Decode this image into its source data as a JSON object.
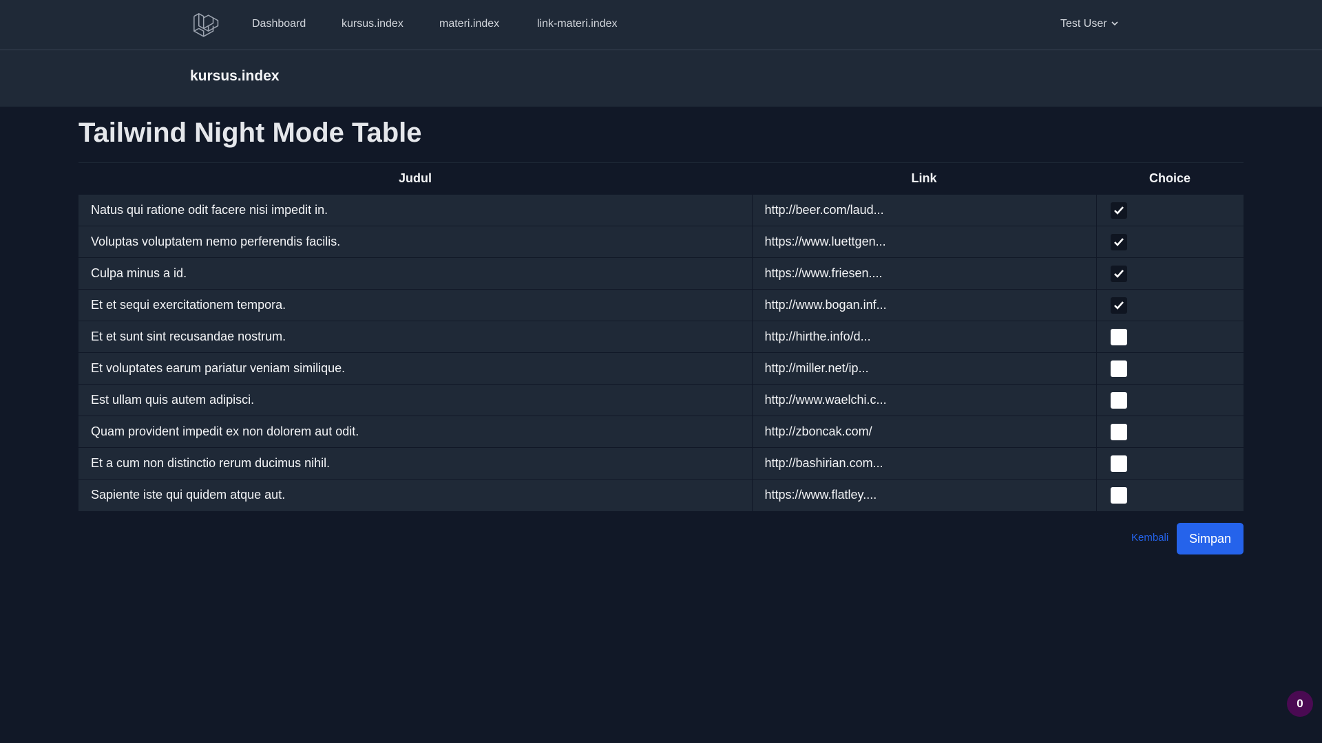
{
  "nav": {
    "items": [
      {
        "label": "Dashboard"
      },
      {
        "label": "kursus.index"
      },
      {
        "label": "materi.index"
      },
      {
        "label": "link-materi.index"
      }
    ],
    "user_name": "Test User"
  },
  "header": {
    "title": "kursus.index"
  },
  "main": {
    "title": "Tailwind Night Mode Table",
    "columns": [
      "Judul",
      "Link",
      "Choice"
    ],
    "rows": [
      {
        "judul": "Natus qui ratione odit facere nisi impedit in.",
        "link": "http://beer.com/laud...",
        "checked": true
      },
      {
        "judul": "Voluptas voluptatem nemo perferendis facilis.",
        "link": "https://www.luettgen...",
        "checked": true
      },
      {
        "judul": "Culpa minus a id.",
        "link": "https://www.friesen....",
        "checked": true
      },
      {
        "judul": "Et et sequi exercitationem tempora.",
        "link": "http://www.bogan.inf...",
        "checked": true
      },
      {
        "judul": "Et et sunt sint recusandae nostrum.",
        "link": "http://hirthe.info/d...",
        "checked": false
      },
      {
        "judul": "Et voluptates earum pariatur veniam similique.",
        "link": "http://miller.net/ip...",
        "checked": false
      },
      {
        "judul": "Est ullam quis autem adipisci.",
        "link": "http://www.waelchi.c...",
        "checked": false
      },
      {
        "judul": "Quam provident impedit ex non dolorem aut odit.",
        "link": "http://zboncak.com/",
        "checked": false
      },
      {
        "judul": "Et a cum non distinctio rerum ducimus nihil.",
        "link": "http://bashirian.com...",
        "checked": false
      },
      {
        "judul": "Sapiente iste qui quidem atque aut.",
        "link": "https://www.flatley....",
        "checked": false
      }
    ],
    "back_label": "Kembali",
    "save_label": "Simpan"
  },
  "badge": {
    "count": "0"
  },
  "colors": {
    "background": "#111827",
    "surface": "#1f2937",
    "accent": "#2563eb",
    "badge": "#4a0a52"
  }
}
